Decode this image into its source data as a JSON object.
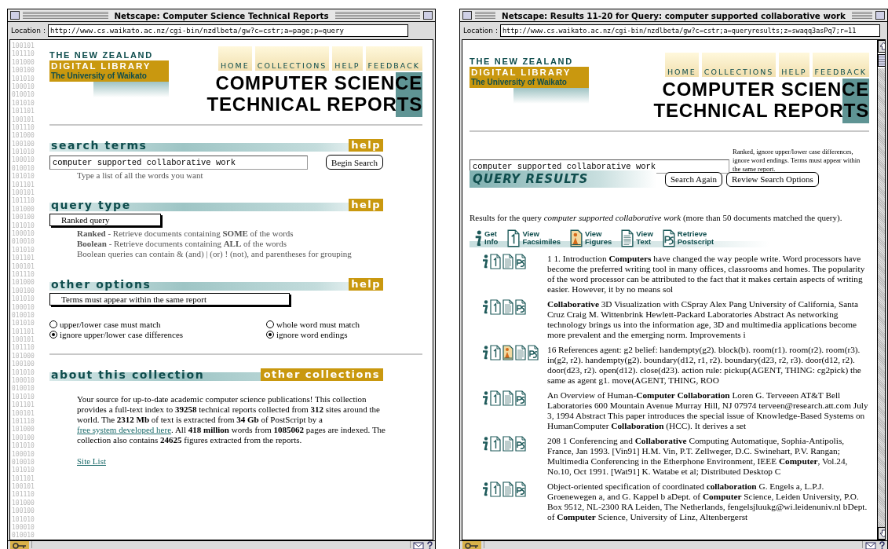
{
  "left_window": {
    "title": "Netscape: Computer Science Technical Reports",
    "location_label": "Location :",
    "location": "http://www.cs.waikato.ac.nz/cgi-bin/nzdlbeta/gw?c=cstr;a=page;p=query",
    "binary_strip": [
      "100101",
      "101110",
      "101000",
      "100100",
      "101010",
      "100010",
      "010010",
      "101010",
      "101101",
      "100101",
      "101110",
      "101000",
      "100100",
      "101010",
      "100010",
      "010010",
      "101010",
      "101101",
      "100101",
      "101110",
      "101000",
      "100100",
      "101010",
      "100010",
      "010010",
      "101010",
      "101101",
      "100101",
      "101110",
      "101000",
      "100100",
      "101010",
      "100010",
      "010010",
      "101010",
      "101101",
      "100101",
      "101110",
      "101000",
      "100100",
      "101010",
      "100010",
      "010010",
      "101010",
      "101101",
      "100101",
      "101110",
      "101000",
      "100100",
      "101010",
      "100010",
      "010010",
      "101010",
      "101101",
      "100101",
      "101110",
      "101000",
      "100100",
      "101010",
      "100010",
      "010010"
    ],
    "logo": {
      "line_1": "THE NEW ZEALAND",
      "line_2": "DIGITAL LIBRARY",
      "line_3": "The University of Waikato"
    },
    "nav": [
      "HOME",
      "COLLECTIONS",
      "HELP",
      "FEEDBACK"
    ],
    "heading": [
      "COMPUTER SCIENCE",
      "TECHNICAL REPORTS"
    ],
    "search_terms": {
      "title": "search terms",
      "help": "help",
      "query": "computer supported collaborative work",
      "button": "Begin Search",
      "hint": "Type a list of all the words you want"
    },
    "query_type": {
      "title": "query type",
      "help": "help",
      "select": "Ranked query",
      "notes": [
        "**Ranked** - Retrieve documents containing **SOME** of the words",
        "**Boolean** - Retrieve documents containing **ALL** of the words",
        "Boolean queries can contain & (and) | (or) ! (not), and parentheses for grouping"
      ]
    },
    "other_options": {
      "title": "other options",
      "help": "help",
      "select": "Terms must appear within the same report",
      "radios": [
        {
          "label": "upper/lower case must match",
          "selected": false
        },
        {
          "label": "whole word must match",
          "selected": false
        },
        {
          "label": "ignore upper/lower case differences",
          "selected": true
        },
        {
          "label": "ignore word endings",
          "selected": true
        }
      ]
    },
    "about": {
      "title": "about this collection",
      "link": "other collections",
      "text_before": "Your source for up-to-date academic computer science publications! This collection provides a full-text index to **39258** technical reports collected from **312** sites around the world. The **2312 Mb** of text is extracted from **34 Gb** of PostScript by a",
      "text_link": "free system developed here",
      "text_after": ". All **418 million** words from **1085062** pages are indexed. The collection also contains **24625** figures extracted from the reports.",
      "site_link": "Site List"
    }
  },
  "right_window": {
    "title": "Netscape: Results 11-20 for Query: computer supported collaborative work",
    "location_label": "Location :",
    "location": "http://www.cs.waikato.ac.nz/cgi-bin/nzdlbeta/gw?c=cstr;a=queryresults;z=swaqq3asPq7;r=11",
    "logo": {
      "line_1": "THE NEW ZEALAND",
      "line_2": "DIGITAL LIBRARY",
      "line_3": "The University of Waikato"
    },
    "nav": [
      "HOME",
      "COLLECTIONS",
      "HELP",
      "FEEDBACK"
    ],
    "heading": [
      "COMPUTER SCIENCE",
      "TECHNICAL REPORTS"
    ],
    "search": {
      "query": "computer supported collaborative work",
      "options_summary": "Ranked, ignore upper/lower case differences, ignore word endings. Terms must appear within the same report.",
      "buttons": [
        "Search Again",
        "Review Search Options"
      ]
    },
    "results_heading": "QUERY RESULTS",
    "summary": "Results for the query *computer supported collaborative work* (more than 50 documents matched the query).",
    "legend": [
      {
        "kind": "info",
        "label": "Get Info"
      },
      {
        "kind": "facsimile",
        "label": "View Facsimiles"
      },
      {
        "kind": "figure",
        "label": "View Figures"
      },
      {
        "kind": "text",
        "label": "View Text"
      },
      {
        "kind": "postscript",
        "label": "Retrieve Postscript"
      }
    ],
    "results": [
      {
        "icons": [
          {
            "kind": "info"
          },
          {
            "kind": "facsimile"
          },
          {
            "kind": "text"
          },
          {
            "kind": "postscript"
          }
        ],
        "text": "1 1. Introduction **Computers** have changed the way people write. Word processors have become the preferred writing tool in many offices, classrooms and homes. The popularity of the word processor can be attributed to the fact that it makes certain aspects of writing easier. However, it by no means sol"
      },
      {
        "icons": [
          {
            "kind": "info"
          },
          {
            "kind": "facsimile"
          },
          {
            "kind": "text"
          },
          {
            "kind": "postscript"
          }
        ],
        "text": "**Collaborative** 3D Visualization with CSpray Alex Pang University of California, Santa Cruz Craig M. Wittenbrink Hewlett-Packard Laboratories Abstract As networking technology brings us into the information age, 3D and multimedia applications become more prevalent and the emerging norm. Improvements i"
      },
      {
        "icons": [
          {
            "kind": "info"
          },
          {
            "kind": "facsimile"
          },
          {
            "kind": "figure"
          },
          {
            "kind": "text"
          },
          {
            "kind": "postscript"
          }
        ],
        "text": "16 References agent: g2 belief: handempty(g2). block(b). room(r1). room(r2). room(r3). in(g2, r2). handempty(g2). boundary(d12, r1, r2). boundary(d23, r2, r3). door(d12, r2). door(d23, r2). open(d12). close(d23). action rule: pickup(AGENT, THING: cg2pick) the same as agent g1. move(AGENT, THING, ROO"
      },
      {
        "icons": [
          {
            "kind": "info"
          },
          {
            "kind": "facsimile"
          },
          {
            "kind": "text"
          },
          {
            "kind": "postscript"
          }
        ],
        "text": "An Overview of Human-**Computer Collaboration** Loren G. Terveeen AT&T Bell Laboratories 600 Mountain Avenue Murray Hill, NJ 07974 terveen@research.att.com July 3, 1994 Abstract This paper introduces the special issue of Knowledge-Based Systems on HumanComputer **Collaboration** (HCC). It derives a set"
      },
      {
        "icons": [
          {
            "kind": "info"
          },
          {
            "kind": "facsimile"
          },
          {
            "kind": "text"
          },
          {
            "kind": "postscript"
          }
        ],
        "text": "208 1 Conferencing and **Collaborative** Computing Automatique, Sophia-Antipolis, France, Jan 1993. [Vin91] H.M. Vin, P.T. Zellweger, D.C. Swinehart, P.V. Rangan; Multimedia Conferencing in the Etherphone Environment, IEEE **Computer**, Vol.24, No.10, Oct 1991. [Wat91] K. Watabe et al; Distributed Desktop C"
      },
      {
        "icons": [
          {
            "kind": "info"
          },
          {
            "kind": "facsimile"
          },
          {
            "kind": "text"
          },
          {
            "kind": "postscript"
          }
        ],
        "text": "Object-oriented specification of coordinated **collaboration** G. Engels a, L.P.J. Groenewegen a, and G. Kappel b aDept. of **Computer** Science, Leiden University, P.O. Box 9512, NL-2300 RA Leiden, The Netherlands, fengelsjluukg@wi.leidenuniv.nl bDept. of **Computer** Science, University of Linz, Altenbergerst"
      }
    ]
  }
}
